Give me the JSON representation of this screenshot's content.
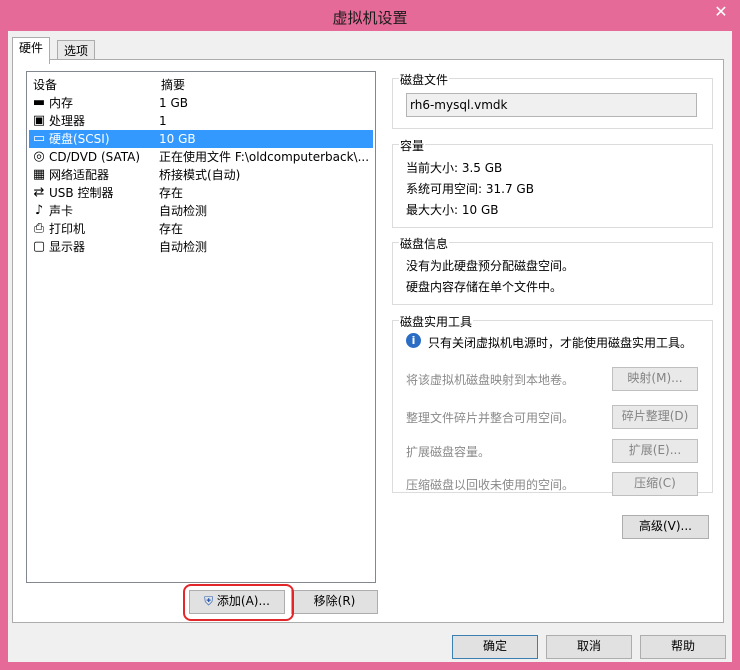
{
  "window": {
    "title": "虚拟机设置",
    "close_glyph": "✕"
  },
  "tabs": [
    {
      "label": "硬件"
    },
    {
      "label": "选项"
    }
  ],
  "device_list": {
    "header_device": "设备",
    "header_summary": "摘要",
    "rows": [
      {
        "icon": "memory-icon",
        "glyph": "▬",
        "name": "内存",
        "summary": "1 GB",
        "selected": false
      },
      {
        "icon": "cpu-icon",
        "glyph": "▣",
        "name": "处理器",
        "summary": "1",
        "selected": false
      },
      {
        "icon": "harddisk-icon",
        "glyph": "▭",
        "name": "硬盘(SCSI)",
        "summary": "10 GB",
        "selected": true
      },
      {
        "icon": "cd-dvd-icon",
        "glyph": "◎",
        "name": "CD/DVD (SATA)",
        "summary": "正在使用文件 F:\\oldcomputerback\\...",
        "selected": false
      },
      {
        "icon": "network-icon",
        "glyph": "▦",
        "name": "网络适配器",
        "summary": "桥接模式(自动)",
        "selected": false
      },
      {
        "icon": "usb-icon",
        "glyph": "⇄",
        "name": "USB 控制器",
        "summary": "存在",
        "selected": false
      },
      {
        "icon": "sound-icon",
        "glyph": "♪",
        "name": "声卡",
        "summary": "自动检测",
        "selected": false
      },
      {
        "icon": "printer-icon",
        "glyph": "⎙",
        "name": "打印机",
        "summary": "存在",
        "selected": false
      },
      {
        "icon": "display-icon",
        "glyph": "▢",
        "name": "显示器",
        "summary": "自动检测",
        "selected": false
      }
    ]
  },
  "buttons": {
    "add": "添加(A)...",
    "remove": "移除(R)",
    "advanced": "高级(V)...",
    "ok": "确定",
    "cancel": "取消",
    "help": "帮助"
  },
  "disk_file": {
    "group_title": "磁盘文件",
    "value": "rh6-mysql.vmdk"
  },
  "capacity": {
    "group_title": "容量",
    "current_size": "当前大小: 3.5 GB",
    "system_free": "系统可用空间: 31.7 GB",
    "max_size": "最大大小: 10 GB"
  },
  "disk_info": {
    "group_title": "磁盘信息",
    "line1": "没有为此硬盘预分配磁盘空间。",
    "line2": "硬盘内容存储在单个文件中。"
  },
  "disk_utilities": {
    "group_title": "磁盘实用工具",
    "notice": "只有关闭虚拟机电源时，才能使用磁盘实用工具。",
    "map_text": "将该虚拟机磁盘映射到本地卷。",
    "map_button": "映射(M)...",
    "defrag_text": "整理文件碎片并整合可用空间。",
    "defrag_button": "碎片整理(D)",
    "expand_text": "扩展磁盘容量。",
    "expand_button": "扩展(E)...",
    "compact_text": "压缩磁盘以回收未使用的空间。",
    "compact_button": "压缩(C)"
  },
  "colors": {
    "frame": "#e56a97",
    "selection": "#3399ff",
    "annotation": "#e3262a"
  }
}
